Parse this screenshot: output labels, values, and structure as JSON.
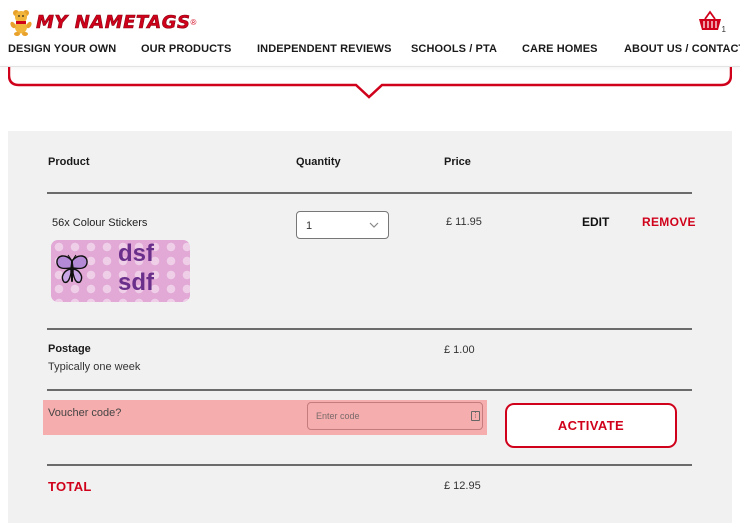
{
  "brand": {
    "name": "MY NAMETAGS",
    "registered_mark": "®",
    "accent_color": "#d0021b"
  },
  "header": {
    "cart_count": "1",
    "cart_icon": "basket-icon",
    "logo_icon": "bear-mascot-icon"
  },
  "nav": {
    "items": [
      {
        "label": "DESIGN YOUR OWN"
      },
      {
        "label": "OUR PRODUCTS"
      },
      {
        "label": "INDEPENDENT REVIEWS"
      },
      {
        "label": "SCHOOLS / PTA"
      },
      {
        "label": "CARE HOMES"
      },
      {
        "label": "ABOUT US / CONTACT"
      }
    ]
  },
  "cart": {
    "columns": {
      "product": "Product",
      "quantity": "Quantity",
      "price": "Price"
    },
    "item": {
      "name": "56x Colour Stickers",
      "quantity": "1",
      "price": "£ 11.95",
      "edit_label": "EDIT",
      "remove_label": "REMOVE",
      "preview": {
        "line1": "dsf",
        "line2": "sdf",
        "icon": "butterfly-icon",
        "background_color": "#e2a8d6",
        "text_color": "#6a2f8a"
      }
    },
    "postage": {
      "label": "Postage",
      "subtitle": "Typically one week",
      "price": "£ 1.00"
    },
    "voucher": {
      "label": "Voucher code?",
      "placeholder": "Enter code",
      "button_label": "ACTIVATE",
      "highlight_color": "#f6adad"
    },
    "total": {
      "label": "TOTAL",
      "price": "£ 12.95"
    }
  }
}
